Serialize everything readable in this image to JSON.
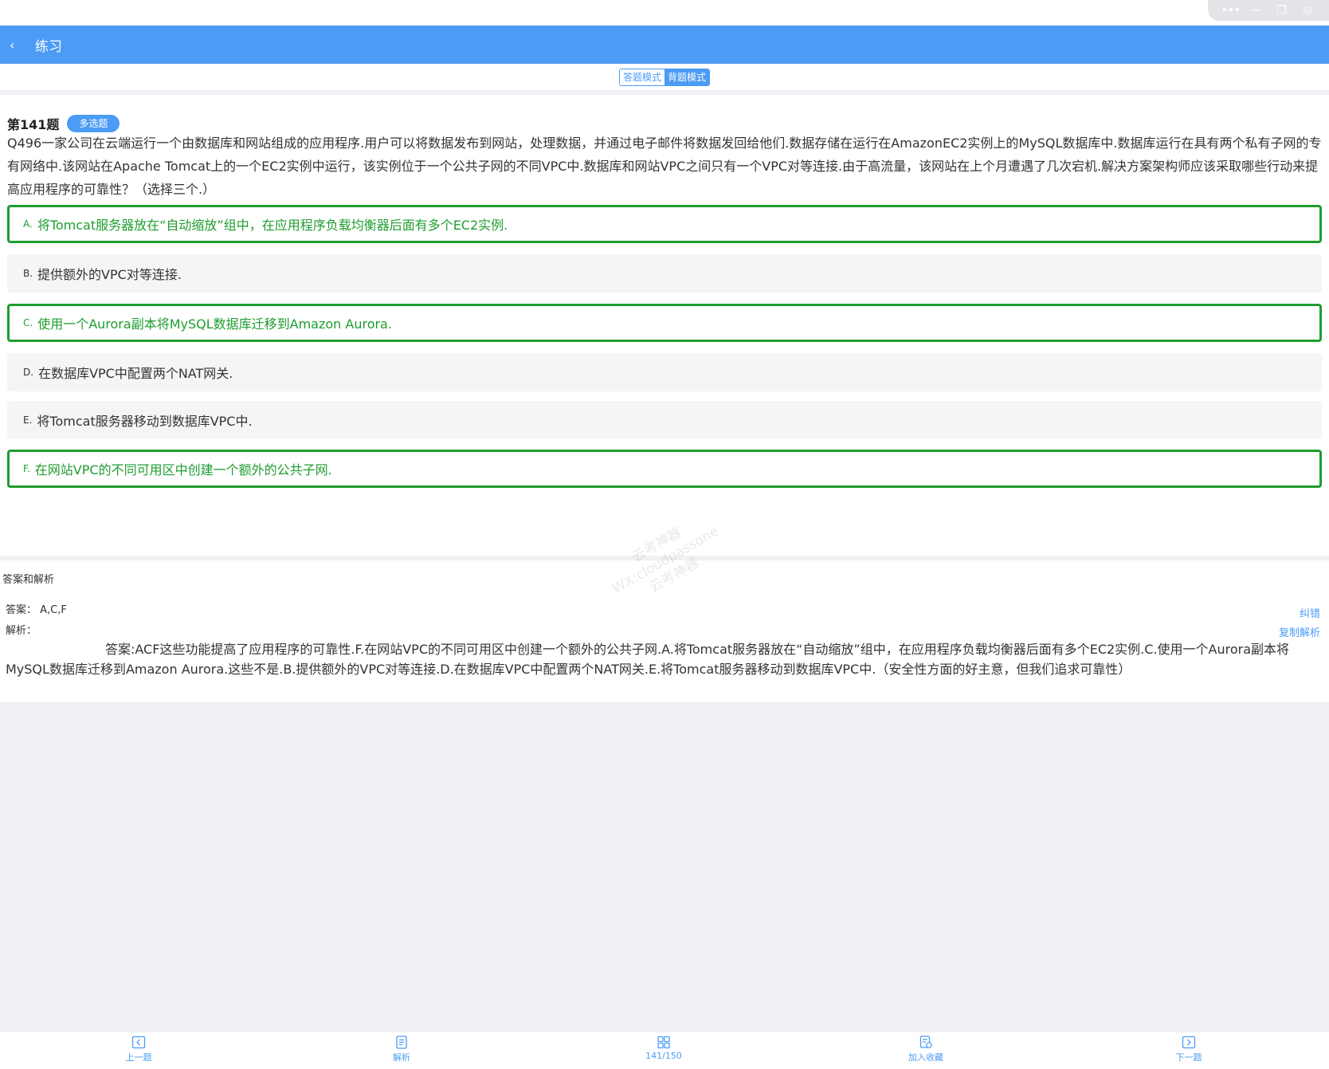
{
  "window": {
    "capsule_icons": [
      "more-icon",
      "minimize-icon",
      "restore-icon",
      "close-icon"
    ]
  },
  "header": {
    "title": "练习"
  },
  "modes": [
    {
      "label": "答题模式",
      "active": false
    },
    {
      "label": "背题模式",
      "active": true
    }
  ],
  "question": {
    "number_label": "第141题",
    "type_badge": "多选题",
    "stem": "Q496一家公司在云端运行一个由数据库和网站组成的应用程序.用户可以将数据发布到网站，处理数据，并通过电子邮件将数据发回给他们.数据存储在运行在AmazonEC2实例上的MySQL数据库中.数据库运行在具有两个私有子网的专有网络中.该网站在Apache Tomcat上的一个EC2实例中运行，该实例位于一个公共子网的不同VPC中.数据库和网站VPC之间只有一个VPC对等连接.由于高流量，该网站在上个月遭遇了几次宕机.解决方案架构师应该采取哪些行动来提高应用程序的可靠性？（选择三个.）",
    "options": [
      {
        "letter": "A.",
        "text": "将Tomcat服务器放在“自动缩放”组中，在应用程序负载均衡器后面有多个EC2实例.",
        "correct": true
      },
      {
        "letter": "B.",
        "text": "提供额外的VPC对等连接.",
        "correct": false
      },
      {
        "letter": "C.",
        "text": "使用一个Aurora副本将MySQL数据库迁移到Amazon Aurora.",
        "correct": true
      },
      {
        "letter": "D.",
        "text": "在数据库VPC中配置两个NAT网关.",
        "correct": false
      },
      {
        "letter": "E.",
        "text": "将Tomcat服务器移动到数据库VPC中.",
        "correct": false
      },
      {
        "letter": "F.",
        "text": "在网站VPC的不同可用区中创建一个额外的公共子网.",
        "correct": true
      }
    ]
  },
  "watermark": {
    "line1": "云考神器",
    "line2": "WX:cloudpassone",
    "line3": "云考神器"
  },
  "answer": {
    "section_title": "答案和解析",
    "answer_line": "答案：  A,C,F",
    "analysis_label": "解析：",
    "report_link": "纠错",
    "copy_link": "复制解析",
    "analysis_text": "答案:ACF这些功能提高了应用程序的可靠性.F.在网站VPC的不同可用区中创建一个额外的公共子网.A.将Tomcat服务器放在“自动缩放”组中，在应用程序负载均衡器后面有多个EC2实例.C.使用一个Aurora副本将MySQL数据库迁移到Amazon Aurora.这些不是.B.提供额外的VPC对等连接.D.在数据库VPC中配置两个NAT网关.E.将Tomcat服务器移动到数据库VPC中.（安全性方面的好主意，但我们追求可靠性）"
  },
  "bottom_nav": [
    {
      "label": "上一题",
      "icon": "prev-icon"
    },
    {
      "label": "解析",
      "icon": "document-icon"
    },
    {
      "label": "141/150",
      "icon": "grid-icon"
    },
    {
      "label": "加入收藏",
      "icon": "favorite-icon"
    },
    {
      "label": "下一题",
      "icon": "next-icon"
    }
  ],
  "colors": {
    "accent": "#4c9bf5",
    "correct": "#1f9d2f",
    "background": "#f1f1f5"
  }
}
